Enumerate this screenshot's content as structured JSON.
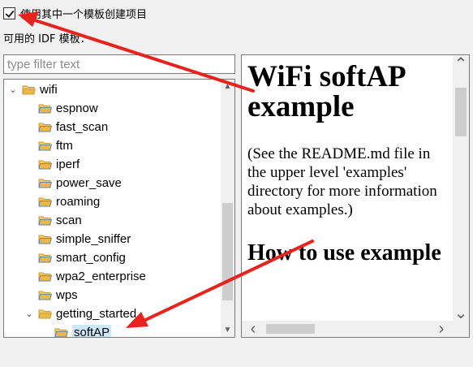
{
  "checkbox": {
    "label": "使用其中一个模板创建项目",
    "checked": true
  },
  "templates_label": "可用的 IDF 模板：",
  "filter": {
    "placeholder": "type filter text",
    "value": ""
  },
  "tree": {
    "items": [
      {
        "label": "wifi",
        "expanded": true
      },
      {
        "label": "espnow"
      },
      {
        "label": "fast_scan"
      },
      {
        "label": "ftm"
      },
      {
        "label": "iperf"
      },
      {
        "label": "power_save"
      },
      {
        "label": "roaming"
      },
      {
        "label": "scan"
      },
      {
        "label": "simple_sniffer"
      },
      {
        "label": "smart_config"
      },
      {
        "label": "wpa2_enterprise"
      },
      {
        "label": "wps"
      },
      {
        "label": "getting_started",
        "expanded": true
      },
      {
        "label": "softAP",
        "selected": true
      }
    ]
  },
  "preview": {
    "title": "WiFi softAP example",
    "paragraph": "(See the README.md file in the upper level 'examples' directory for more information about examples.)",
    "heading2": "How to use example"
  },
  "colors": {
    "annotation_arrow": "#e8231d",
    "selection": "#cce8ff",
    "folder": "#e8b84a"
  }
}
